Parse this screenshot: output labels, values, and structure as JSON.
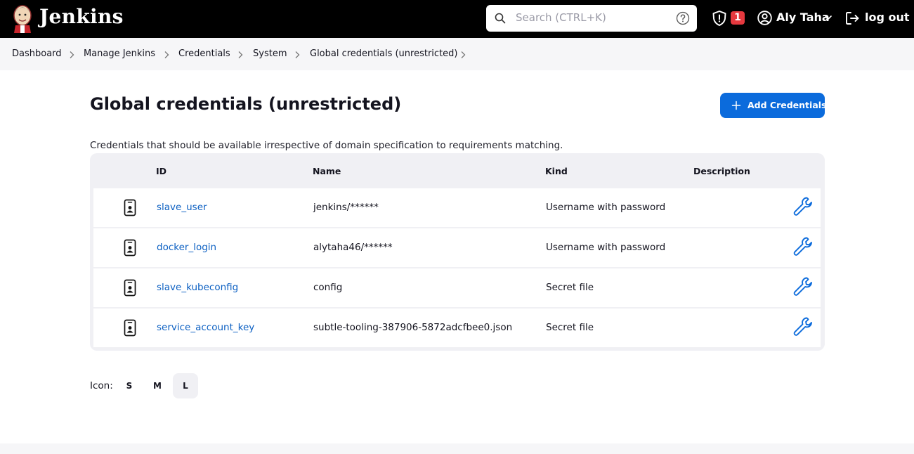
{
  "header": {
    "brand": "Jenkins",
    "search_placeholder": "Search (CTRL+K)",
    "security_badge_count": "1",
    "user_name": "Aly Taha",
    "logout_label": "log out"
  },
  "breadcrumb": [
    {
      "label": "Dashboard"
    },
    {
      "label": "Manage Jenkins"
    },
    {
      "label": "Credentials"
    },
    {
      "label": "System"
    },
    {
      "label": "Global credentials (unrestricted)"
    }
  ],
  "page": {
    "title": "Global credentials (unrestricted)",
    "add_button_label": "Add Credentials",
    "description": "Credentials that should be available irrespective of domain specification to requirements matching."
  },
  "table": {
    "columns": [
      "ID",
      "Name",
      "Kind",
      "Description"
    ],
    "rows": [
      {
        "id": "slave_user",
        "name": "jenkins/******",
        "kind": "Username with password",
        "description": ""
      },
      {
        "id": "docker_login",
        "name": "alytaha46/******",
        "kind": "Username with password",
        "description": ""
      },
      {
        "id": "slave_kubeconfig",
        "name": "config",
        "kind": "Secret file",
        "description": ""
      },
      {
        "id": "service_account_key",
        "name": "subtle-tooling-387906-5872adcfbee0.json",
        "kind": "Secret file",
        "description": ""
      }
    ]
  },
  "icon_size": {
    "label": "Icon:",
    "options": [
      "S",
      "M",
      "L"
    ],
    "selected": "L"
  },
  "colors": {
    "accent": "#0b6bdc",
    "link": "#0b5fc2",
    "badge": "#e5393f",
    "header_bg": "#000000"
  }
}
